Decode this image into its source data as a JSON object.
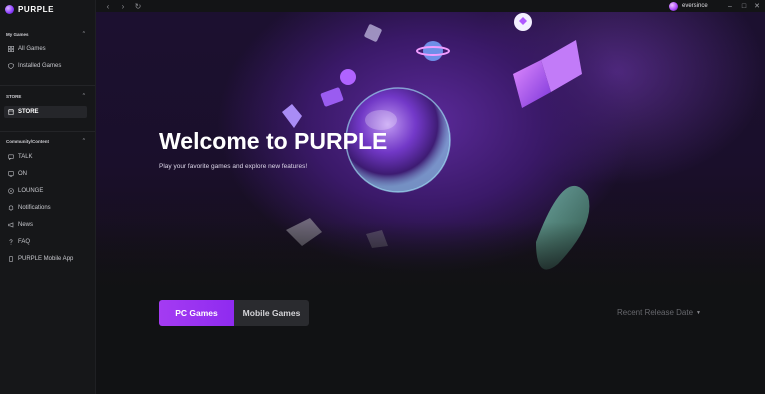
{
  "app": {
    "name": "PURPLE",
    "brand_color": "#8a3bff"
  },
  "sidebar": {
    "sections": [
      {
        "title": "My Games",
        "items": [
          {
            "label": "All Games",
            "icon": "grid-icon"
          },
          {
            "label": "Installed Games",
            "icon": "shield-icon"
          }
        ]
      },
      {
        "title": "STORE",
        "items": [
          {
            "label": "STORE",
            "icon": "store-icon",
            "active": true
          }
        ]
      },
      {
        "title": "Community/Content",
        "items": [
          {
            "label": "TALK",
            "icon": "chat-icon"
          },
          {
            "label": "ON",
            "icon": "monitor-icon"
          },
          {
            "label": "LOUNGE",
            "icon": "lounge-icon"
          },
          {
            "label": "Notifications",
            "icon": "bell-icon"
          },
          {
            "label": "News",
            "icon": "megaphone-icon"
          },
          {
            "label": "FAQ",
            "icon": "question-icon"
          },
          {
            "label": "PURPLE Mobile App",
            "icon": "phone-icon"
          }
        ]
      }
    ]
  },
  "topbar": {
    "username": "eversince"
  },
  "hero": {
    "title": "Welcome to PURPLE",
    "subtitle": "Play your favorite games and explore new features!"
  },
  "tabs": [
    {
      "label": "PC Games",
      "active": true
    },
    {
      "label": "Mobile Games",
      "active": false
    }
  ],
  "sort": {
    "label": "Recent Release Date"
  },
  "colors": {
    "tab_active": "#9b34f1",
    "tab_inactive": "#2a2b2f",
    "background": "#111214"
  }
}
